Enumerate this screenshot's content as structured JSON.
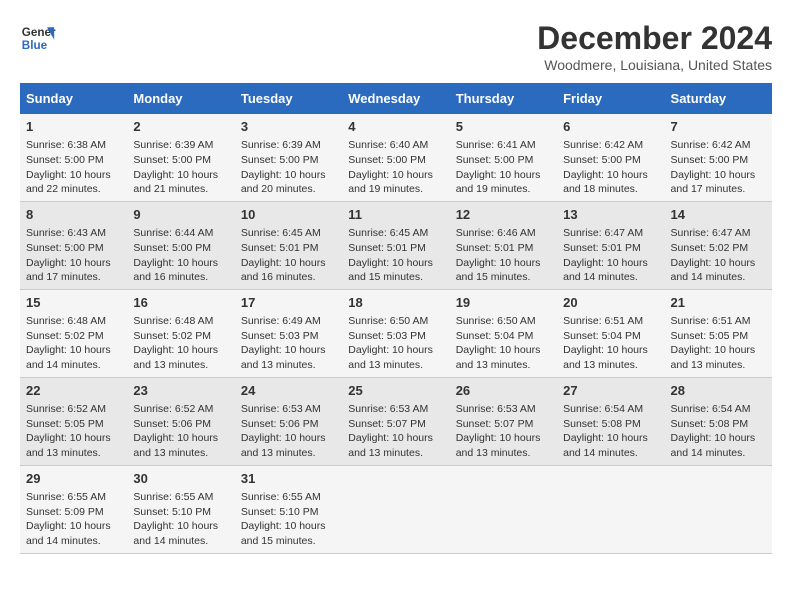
{
  "header": {
    "logo_line1": "General",
    "logo_line2": "Blue",
    "month": "December 2024",
    "location": "Woodmere, Louisiana, United States"
  },
  "weekdays": [
    "Sunday",
    "Monday",
    "Tuesday",
    "Wednesday",
    "Thursday",
    "Friday",
    "Saturday"
  ],
  "weeks": [
    [
      {
        "day": "1",
        "info": "Sunrise: 6:38 AM\nSunset: 5:00 PM\nDaylight: 10 hours\nand 22 minutes."
      },
      {
        "day": "2",
        "info": "Sunrise: 6:39 AM\nSunset: 5:00 PM\nDaylight: 10 hours\nand 21 minutes."
      },
      {
        "day": "3",
        "info": "Sunrise: 6:39 AM\nSunset: 5:00 PM\nDaylight: 10 hours\nand 20 minutes."
      },
      {
        "day": "4",
        "info": "Sunrise: 6:40 AM\nSunset: 5:00 PM\nDaylight: 10 hours\nand 19 minutes."
      },
      {
        "day": "5",
        "info": "Sunrise: 6:41 AM\nSunset: 5:00 PM\nDaylight: 10 hours\nand 19 minutes."
      },
      {
        "day": "6",
        "info": "Sunrise: 6:42 AM\nSunset: 5:00 PM\nDaylight: 10 hours\nand 18 minutes."
      },
      {
        "day": "7",
        "info": "Sunrise: 6:42 AM\nSunset: 5:00 PM\nDaylight: 10 hours\nand 17 minutes."
      }
    ],
    [
      {
        "day": "8",
        "info": "Sunrise: 6:43 AM\nSunset: 5:00 PM\nDaylight: 10 hours\nand 17 minutes."
      },
      {
        "day": "9",
        "info": "Sunrise: 6:44 AM\nSunset: 5:00 PM\nDaylight: 10 hours\nand 16 minutes."
      },
      {
        "day": "10",
        "info": "Sunrise: 6:45 AM\nSunset: 5:01 PM\nDaylight: 10 hours\nand 16 minutes."
      },
      {
        "day": "11",
        "info": "Sunrise: 6:45 AM\nSunset: 5:01 PM\nDaylight: 10 hours\nand 15 minutes."
      },
      {
        "day": "12",
        "info": "Sunrise: 6:46 AM\nSunset: 5:01 PM\nDaylight: 10 hours\nand 15 minutes."
      },
      {
        "day": "13",
        "info": "Sunrise: 6:47 AM\nSunset: 5:01 PM\nDaylight: 10 hours\nand 14 minutes."
      },
      {
        "day": "14",
        "info": "Sunrise: 6:47 AM\nSunset: 5:02 PM\nDaylight: 10 hours\nand 14 minutes."
      }
    ],
    [
      {
        "day": "15",
        "info": "Sunrise: 6:48 AM\nSunset: 5:02 PM\nDaylight: 10 hours\nand 14 minutes."
      },
      {
        "day": "16",
        "info": "Sunrise: 6:48 AM\nSunset: 5:02 PM\nDaylight: 10 hours\nand 13 minutes."
      },
      {
        "day": "17",
        "info": "Sunrise: 6:49 AM\nSunset: 5:03 PM\nDaylight: 10 hours\nand 13 minutes."
      },
      {
        "day": "18",
        "info": "Sunrise: 6:50 AM\nSunset: 5:03 PM\nDaylight: 10 hours\nand 13 minutes."
      },
      {
        "day": "19",
        "info": "Sunrise: 6:50 AM\nSunset: 5:04 PM\nDaylight: 10 hours\nand 13 minutes."
      },
      {
        "day": "20",
        "info": "Sunrise: 6:51 AM\nSunset: 5:04 PM\nDaylight: 10 hours\nand 13 minutes."
      },
      {
        "day": "21",
        "info": "Sunrise: 6:51 AM\nSunset: 5:05 PM\nDaylight: 10 hours\nand 13 minutes."
      }
    ],
    [
      {
        "day": "22",
        "info": "Sunrise: 6:52 AM\nSunset: 5:05 PM\nDaylight: 10 hours\nand 13 minutes."
      },
      {
        "day": "23",
        "info": "Sunrise: 6:52 AM\nSunset: 5:06 PM\nDaylight: 10 hours\nand 13 minutes."
      },
      {
        "day": "24",
        "info": "Sunrise: 6:53 AM\nSunset: 5:06 PM\nDaylight: 10 hours\nand 13 minutes."
      },
      {
        "day": "25",
        "info": "Sunrise: 6:53 AM\nSunset: 5:07 PM\nDaylight: 10 hours\nand 13 minutes."
      },
      {
        "day": "26",
        "info": "Sunrise: 6:53 AM\nSunset: 5:07 PM\nDaylight: 10 hours\nand 13 minutes."
      },
      {
        "day": "27",
        "info": "Sunrise: 6:54 AM\nSunset: 5:08 PM\nDaylight: 10 hours\nand 14 minutes."
      },
      {
        "day": "28",
        "info": "Sunrise: 6:54 AM\nSunset: 5:08 PM\nDaylight: 10 hours\nand 14 minutes."
      }
    ],
    [
      {
        "day": "29",
        "info": "Sunrise: 6:55 AM\nSunset: 5:09 PM\nDaylight: 10 hours\nand 14 minutes."
      },
      {
        "day": "30",
        "info": "Sunrise: 6:55 AM\nSunset: 5:10 PM\nDaylight: 10 hours\nand 14 minutes."
      },
      {
        "day": "31",
        "info": "Sunrise: 6:55 AM\nSunset: 5:10 PM\nDaylight: 10 hours\nand 15 minutes."
      },
      {
        "day": "",
        "info": ""
      },
      {
        "day": "",
        "info": ""
      },
      {
        "day": "",
        "info": ""
      },
      {
        "day": "",
        "info": ""
      }
    ]
  ]
}
